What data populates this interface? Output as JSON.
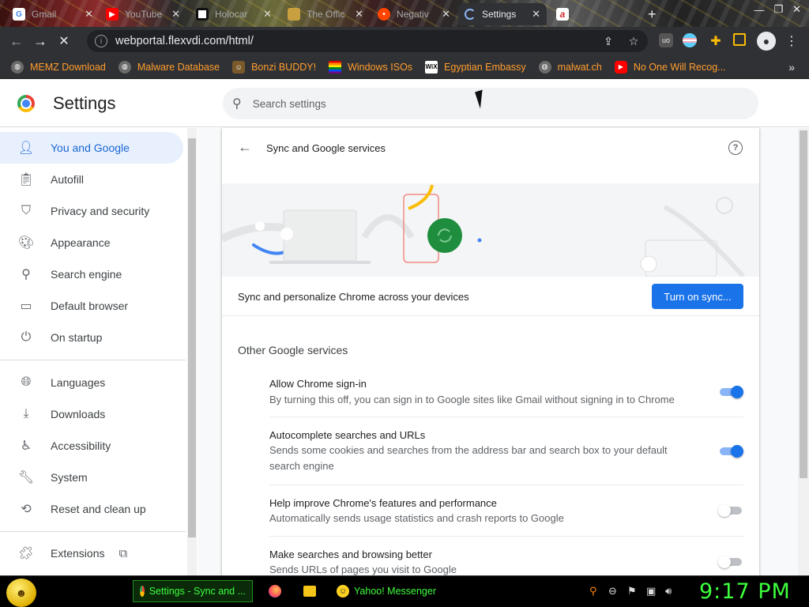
{
  "browser": {
    "tabs": [
      {
        "title": "Gmail",
        "favicon": "google-icon",
        "color": "#4285f4",
        "letter": "G",
        "active": false
      },
      {
        "title": "YouTube",
        "favicon": "youtube-icon",
        "color": "#ff0000",
        "letter": "▶",
        "active": false
      },
      {
        "title": "Holocar",
        "favicon": "flag-icon",
        "color": "#ffffff",
        "letter": "",
        "active": false
      },
      {
        "title": "The Offic",
        "favicon": "office-icon",
        "color": "#c8a040",
        "letter": "",
        "active": false
      },
      {
        "title": "Negativ",
        "favicon": "reddit-icon",
        "color": "#ff4500",
        "letter": "•",
        "active": false
      },
      {
        "title": "Settings",
        "favicon": "loading-icon",
        "color": "#8ab4f8",
        "letter": "",
        "active": true
      },
      {
        "title": "",
        "favicon": "a-icon",
        "color": "#d32f2f",
        "letter": "a",
        "active": false
      }
    ],
    "new_tab": "+",
    "url": "webportal.flexvdi.com/html/",
    "bookmarks": [
      {
        "label": "MEMZ Download",
        "icon": "globe-icon"
      },
      {
        "label": "Malware Database",
        "icon": "globe-icon"
      },
      {
        "label": "Bonzi BUDDY!",
        "icon": "bonzi-icon"
      },
      {
        "label": "Windows ISOs",
        "icon": "rainbow-flag-icon"
      },
      {
        "label": "Egyptian Embassy",
        "icon": "wix-icon"
      },
      {
        "label": "malwat.ch",
        "icon": "globe-icon"
      },
      {
        "label": "No One Will Recog...",
        "icon": "youtube-icon"
      }
    ],
    "bookmarks_overflow": "»"
  },
  "settings": {
    "title": "Settings",
    "search_placeholder": "Search settings",
    "sidebar": [
      {
        "label": "You and Google",
        "icon": "person-icon",
        "active": true
      },
      {
        "label": "Autofill",
        "icon": "clipboard-icon",
        "active": false
      },
      {
        "label": "Privacy and security",
        "icon": "shield-icon",
        "active": false
      },
      {
        "label": "Appearance",
        "icon": "palette-icon",
        "active": false
      },
      {
        "label": "Search engine",
        "icon": "search-icon",
        "active": false
      },
      {
        "label": "Default browser",
        "icon": "browser-icon",
        "active": false
      },
      {
        "label": "On startup",
        "icon": "power-icon",
        "active": false
      },
      {
        "label": "Languages",
        "icon": "globe-icon",
        "active": false
      },
      {
        "label": "Downloads",
        "icon": "download-icon",
        "active": false
      },
      {
        "label": "Accessibility",
        "icon": "accessibility-icon",
        "active": false
      },
      {
        "label": "System",
        "icon": "wrench-icon",
        "active": false
      },
      {
        "label": "Reset and clean up",
        "icon": "history-icon",
        "active": false
      },
      {
        "label": "Extensions",
        "icon": "puzzle-icon",
        "active": false
      }
    ],
    "page": {
      "title": "Sync and Google services",
      "sync_text": "Sync and personalize Chrome across your devices",
      "sync_button": "Turn on sync...",
      "other_section": "Other Google services",
      "rows": [
        {
          "title": "Allow Chrome sign-in",
          "desc": "By turning this off, you can sign in to Google sites like Gmail without signing in to Chrome",
          "on": true
        },
        {
          "title": "Autocomplete searches and URLs",
          "desc": "Sends some cookies and searches from the address bar and search box to your default search engine",
          "on": true
        },
        {
          "title": "Help improve Chrome's features and performance",
          "desc": "Automatically sends usage statistics and crash reports to Google",
          "on": false
        },
        {
          "title": "Make searches and browsing better",
          "desc": "Sends URLs of pages you visit to Google",
          "on": false
        }
      ]
    }
  },
  "taskbar": {
    "items": [
      {
        "label": "Settings - Sync and ...",
        "icon": "chrome-icon",
        "active": true
      },
      {
        "label": "",
        "icon": "firefox-icon",
        "active": false
      },
      {
        "label": "",
        "icon": "folder-icon",
        "active": false
      },
      {
        "label": "Yahoo! Messenger",
        "icon": "yahoo-icon",
        "active": false
      }
    ],
    "clock": "9:17 PM"
  },
  "colors": {
    "accent": "#1a73e8",
    "bookmark_text": "#ff9d2e",
    "taskbar_text": "#3dff3d"
  }
}
